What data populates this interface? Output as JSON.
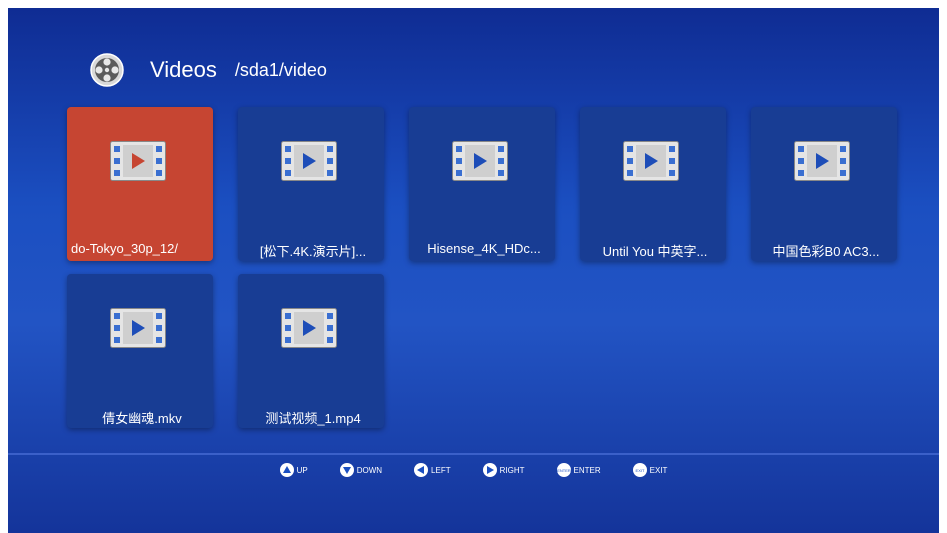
{
  "header": {
    "title": "Videos",
    "path": "/sda1/video",
    "app_icon": "film-reel-icon"
  },
  "files": [
    {
      "name": "do-Tokyo_30p_12/",
      "icon": "video-file-icon",
      "selected": true
    },
    {
      "name": "[松下.4K.演示片]...",
      "icon": "video-file-icon"
    },
    {
      "name": "Hisense_4K_HDc...",
      "icon": "video-file-icon"
    },
    {
      "name": "Until You 中英字...",
      "icon": "video-file-icon"
    },
    {
      "name": "中国色彩B0 AC3...",
      "icon": "video-file-icon"
    },
    {
      "name": "倩女幽魂.mkv",
      "icon": "video-file-icon"
    },
    {
      "name": "测试视频_1.mp4",
      "icon": "video-file-icon"
    }
  ],
  "footer": {
    "hints": [
      {
        "label": "UP",
        "icon": "up-arrow-icon"
      },
      {
        "label": "DOWN",
        "icon": "down-arrow-icon"
      },
      {
        "label": "LEFT",
        "icon": "left-arrow-icon"
      },
      {
        "label": "RIGHT",
        "icon": "right-arrow-icon"
      },
      {
        "label": "ENTER",
        "icon": "enter-key-icon",
        "key": "ENTER"
      },
      {
        "label": "EXIT",
        "icon": "exit-key-icon",
        "key": "EXIT"
      }
    ]
  },
  "colors": {
    "background": "#1b4fc1",
    "tile": "#183d94",
    "selected_tile": "#c64532"
  }
}
